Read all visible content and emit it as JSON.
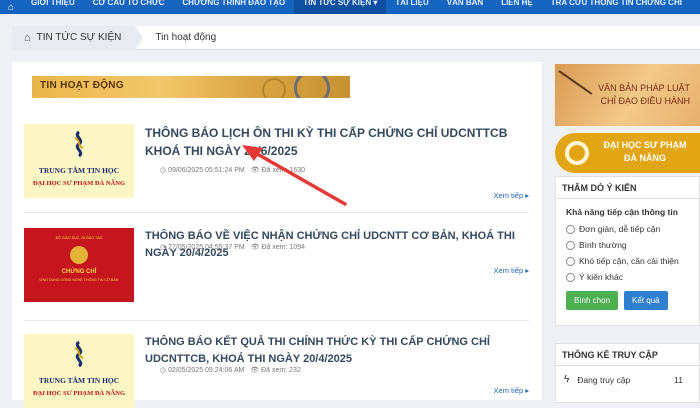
{
  "nav": {
    "items": [
      {
        "label": "GIỚI THIỆU"
      },
      {
        "label": "CƠ CẤU TỔ CHỨC"
      },
      {
        "label": "CHƯƠNG TRÌNH ĐÀO TẠO"
      },
      {
        "label": "TIN TỨC SỰ KIỆN ▾",
        "active": true
      },
      {
        "label": "TÀI LIỆU"
      },
      {
        "label": "VĂN BẢN"
      },
      {
        "label": "LIÊN HỆ"
      },
      {
        "label": "TRA CỨU THÔNG TIN CHỨNG CHỈ"
      }
    ],
    "home_icon": "home-icon"
  },
  "breadcrumb": {
    "home_label": "TIN TỨC SỰ KIỆN",
    "current": "Tin hoạt động"
  },
  "banner": {
    "label": "TIN HOẠT ĐỘNG"
  },
  "posts": [
    {
      "title": "THÔNG BÁO LỊCH ÔN THI KỲ THI CẤP CHỨNG CHỈ UDCNTTCB KHOÁ THI NGÀY 22/6/2025",
      "date": "09/06/2025 05:51:24 PM",
      "views": "Đã xem: 1630",
      "more": "Xem tiếp ▸",
      "thumb_line1": "TRUNG TÂM TIN HỌC",
      "thumb_line2": "ĐẠI HỌC SƯ PHẠM ĐÀ NẴNG"
    },
    {
      "title": "THÔNG BÁO VỀ VIỆC NHẬN CHỨNG CHỈ UDCNTT CƠ BẢN, KHOÁ THI NGÀY 20/4/2025",
      "date": "27/05/2025 04:55:37 PM",
      "views": "Đã xem: 1094",
      "more": "Xem tiếp ▸",
      "thumb_cap": "CHỨNG CHỈ",
      "thumb_sub": "ỨNG DỤNG CÔNG NGHỆ THÔNG TIN CƠ BẢN",
      "thumb_hdr": "BỘ GIÁO DỤC VÀ ĐÀO TẠO"
    },
    {
      "title": "THÔNG BÁO KẾT QUẢ THI CHÍNH THỨC KỲ THI CẤP CHỨNG CHỈ UDCNTTCB, KHOÁ THI NGÀY 20/4/2025",
      "date": "02/05/2025 09:24:06 AM",
      "views": "Đã xem: 232",
      "more": "Xem tiếp ▸",
      "thumb_line1": "TRUNG TÂM TIN HỌC",
      "thumb_line2": "ĐẠI HỌC SƯ PHẠM ĐÀ NẴNG"
    }
  ],
  "sidebar": {
    "adv1": {
      "line1": "VĂN BẢN PHÁP LUẬT",
      "line2": "CHỈ ĐẠO ĐIỀU HÀNH"
    },
    "adv2": {
      "line1": "ĐẠI HỌC SƯ PHẠM",
      "line2": "ĐÀ NẴNG"
    },
    "poll": {
      "title": "THĂM DÒ Ý KIẾN",
      "question": "Khả năng tiếp cận thông tin",
      "options": [
        "Đơn giản, dễ tiếp cận",
        "Bình thường",
        "Khó tiếp cận, cần cải thiện",
        "Ý kiến khác"
      ],
      "vote_label": "Bình chọn",
      "result_label": "Kết quả"
    },
    "stats": {
      "title": "THỐNG KÊ TRUY CẬP",
      "online_label": "Đang truy cập",
      "online_count": "11"
    }
  },
  "colors": {
    "nav_bg": "#1565c0",
    "link": "#1e63b5",
    "title": "#34495e",
    "annotation_arrow": "#e53935"
  }
}
